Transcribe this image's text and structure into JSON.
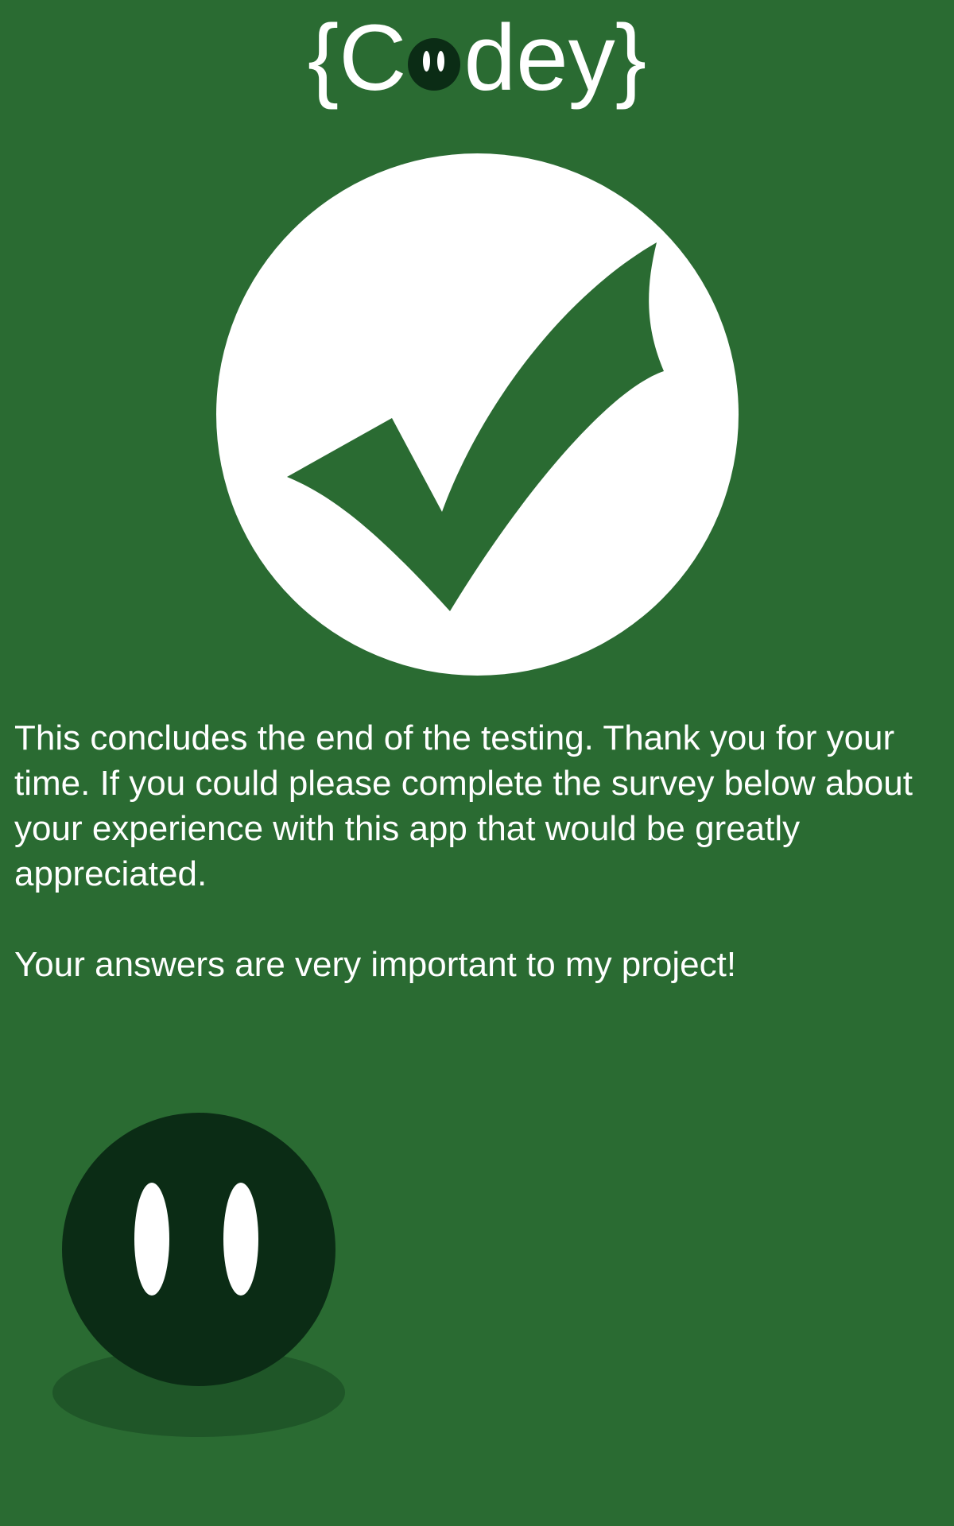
{
  "app": {
    "logo_left": "{C",
    "logo_right": "dey}",
    "logo_eye_icon": "codey-eye-icon"
  },
  "content": {
    "status_icon": "checkmark-circle-icon",
    "message_paragraph_1": "This concludes the end of the testing. Thank you for your time. If you could please complete the survey below about your experience with this app that would be greatly appreciated.",
    "message_paragraph_2": "Your answers are very important to my project!"
  },
  "mascot": {
    "icon": "codey-mascot-icon"
  },
  "colors": {
    "background": "#2a6b32",
    "text": "#ffffff",
    "mascot": "#0b2c15",
    "shadow": "#1f5628"
  }
}
